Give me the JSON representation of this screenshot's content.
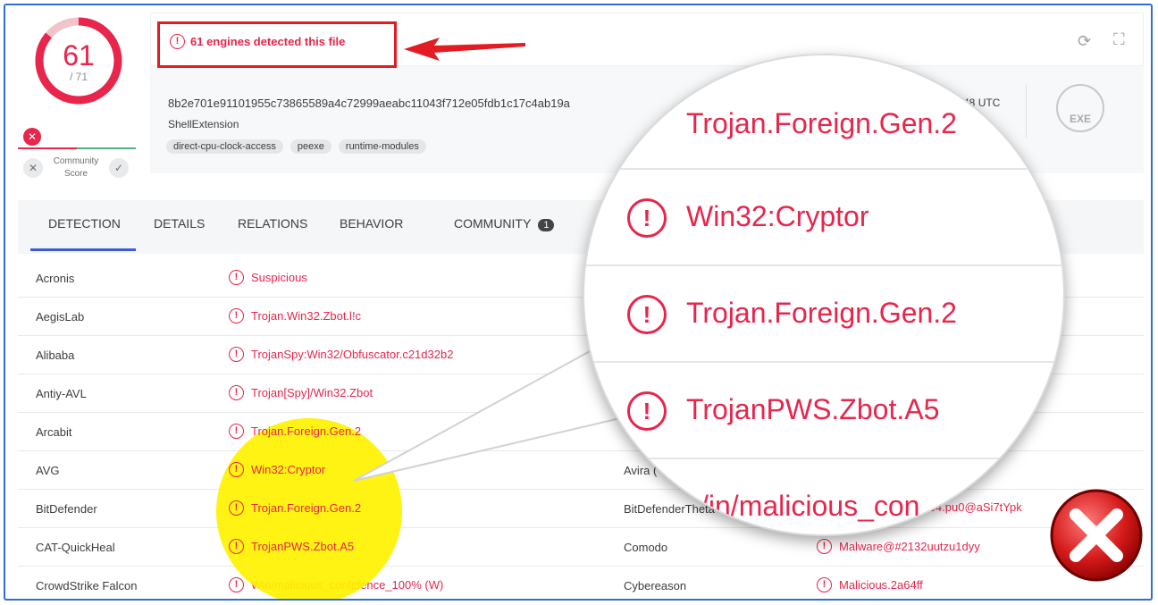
{
  "score": {
    "detected": "61",
    "total": "/ 71",
    "community_label_1": "Community",
    "community_label_2": "Score"
  },
  "header": {
    "detection_alert": "61 engines detected this file",
    "sha256": "8b2e701e91101955c73865589a4c72999aeabc11043f712e05fdb1c17c4ab19a",
    "filename": "ShellExtension",
    "tags": [
      "direct-cpu-clock-access",
      "peexe",
      "runtime-modules"
    ],
    "date_fragment": "8:48 UTC",
    "filetype": "EXE"
  },
  "tabs": [
    {
      "label": "DETECTION"
    },
    {
      "label": "DETAILS"
    },
    {
      "label": "RELATIONS"
    },
    {
      "label": "BEHAVIOR"
    },
    {
      "label": "COMMUNITY",
      "badge": "1"
    }
  ],
  "detections_left": [
    {
      "engine": "Acronis",
      "result": "Suspicious"
    },
    {
      "engine": "AegisLab",
      "result": "Trojan.Win32.Zbot.l!c"
    },
    {
      "engine": "Alibaba",
      "result": "TrojanSpy:Win32/Obfuscator.c21d32b2"
    },
    {
      "engine": "Antiy-AVL",
      "result": "Trojan[Spy]/Win32.Zbot"
    },
    {
      "engine": "Arcabit",
      "result": "Trojan.Foreign.Gen.2"
    },
    {
      "engine": "AVG",
      "result": "Win32:Cryptor"
    },
    {
      "engine": "BitDefender",
      "result": "Trojan.Foreign.Gen.2"
    },
    {
      "engine": "CAT-QuickHeal",
      "result": "TrojanPWS.Zbot.A5"
    },
    {
      "engine": "CrowdStrike Falcon",
      "result": "Win/malicious_confidence_100% (W)"
    }
  ],
  "detections_right": [
    {
      "engine": "Avira (",
      "result": ""
    },
    {
      "engine": "BitDefenderTheta",
      "result": "34804.pu0@aSi7tYpk"
    },
    {
      "engine": "Comodo",
      "result": "Malware@#2132uutzu1dyy"
    },
    {
      "engine": "Cybereason",
      "result": "Malicious.2a64ff"
    }
  ],
  "magnifier": [
    "Trojan.Foreign.Gen.2",
    "Win32:Cryptor",
    "Trojan.Foreign.Gen.2",
    "TrojanPWS.Zbot.A5",
    "/in/malicious_con"
  ],
  "colors": {
    "alert_red": "#e8254b",
    "tab_accent": "#3b5bdb",
    "frame_blue": "#2e6fd6",
    "highlight_yellow": "#fff200"
  }
}
